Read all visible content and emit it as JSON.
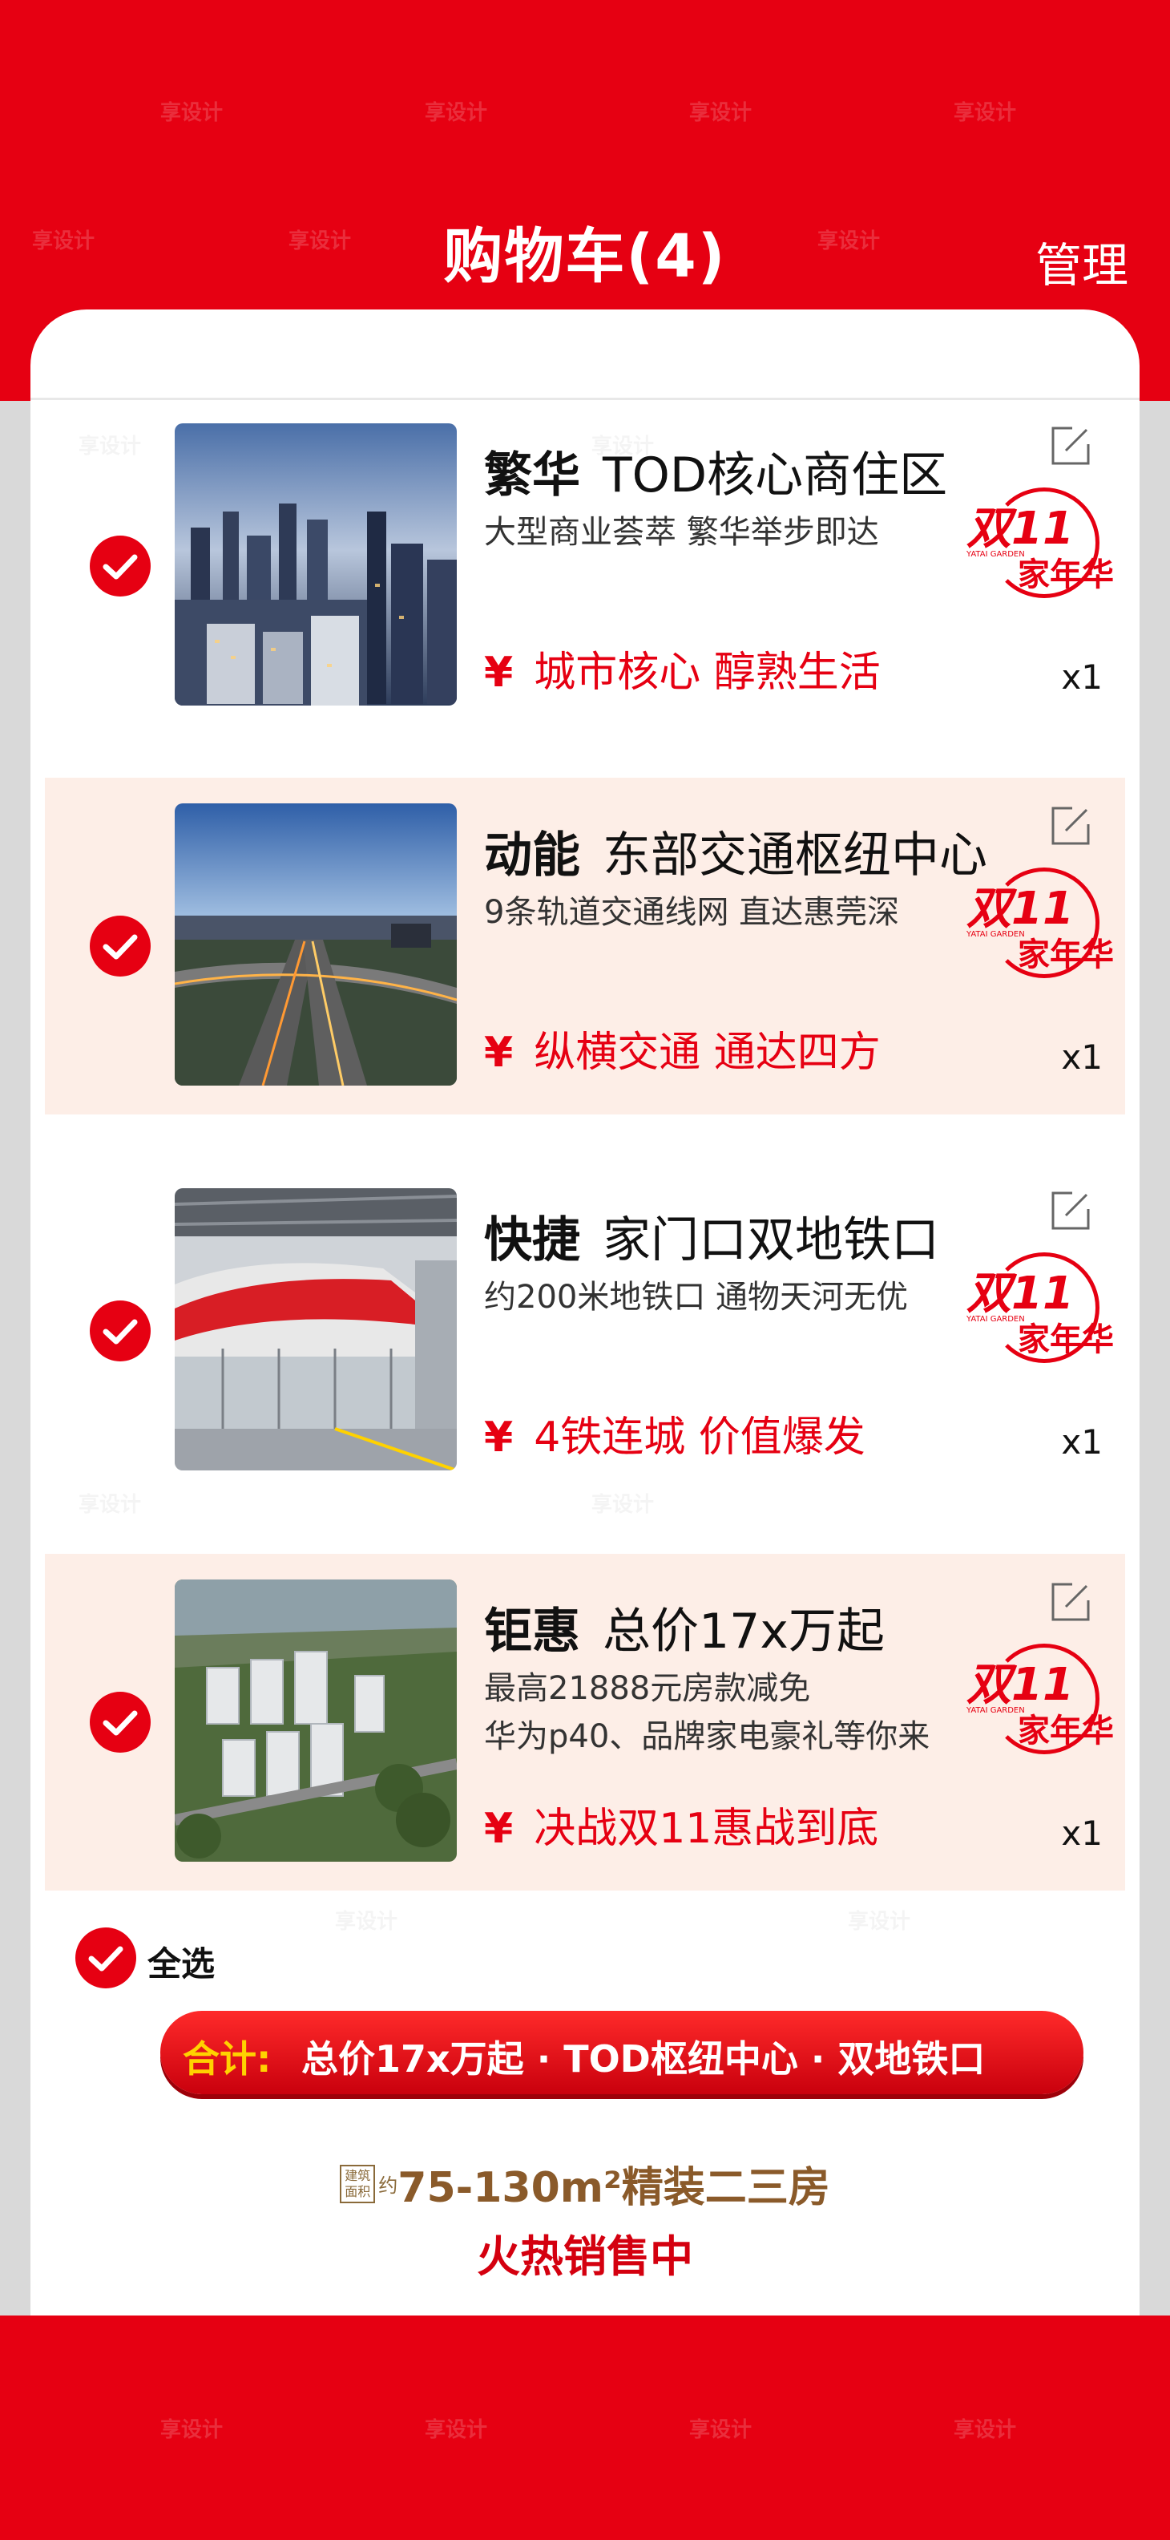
{
  "header": {
    "title": "购物车(4)",
    "manage_label": "管理"
  },
  "items": [
    {
      "title_strong": "繁华",
      "title_rest": "TOD核心商住区",
      "subtitle_lines": [
        "大型商业荟萃 繁华举步即达"
      ],
      "price_symbol": "¥",
      "price_text": "城市核心 醇熟生活",
      "quantity": "x1",
      "checked": true
    },
    {
      "title_strong": "动能",
      "title_rest": "东部交通枢纽中心",
      "subtitle_lines": [
        "9条轨道交通线网 直达惠莞深"
      ],
      "price_symbol": "¥",
      "price_text": "纵横交通 通达四方",
      "quantity": "x1",
      "checked": true
    },
    {
      "title_strong": "快捷",
      "title_rest": "家门口双地铁口",
      "subtitle_lines": [
        "约200米地铁口 通物天河无优"
      ],
      "price_symbol": "¥",
      "price_text": "4铁连城 价值爆发",
      "quantity": "x1",
      "checked": true
    },
    {
      "title_strong": "钜惠",
      "title_rest": "总价17x万起",
      "subtitle_lines": [
        "最高21888元房款减免",
        "华为p40、品牌家电豪礼等你来"
      ],
      "price_symbol": "¥",
      "price_text": "决战双11惠战到底",
      "quantity": "x1",
      "checked": true
    }
  ],
  "promo_badge": {
    "big": "双11",
    "small": "家年华",
    "tiny": "YATAI GARDEN"
  },
  "select_all_label": "全选",
  "total": {
    "label": "合计:",
    "text": "总价17x万起 · TOD枢纽中心 · 双地铁口"
  },
  "area": {
    "badge_line1": "建筑",
    "badge_line2": "面积",
    "approx": "约",
    "main": "75-130m²精装二三房"
  },
  "hot_sale": "火热销售中",
  "watermark": "享设计",
  "colors": {
    "brand_red": "#e60012",
    "tint": "#fdeee7",
    "gold": "#ffd200",
    "brown": "#8a5a2a"
  }
}
